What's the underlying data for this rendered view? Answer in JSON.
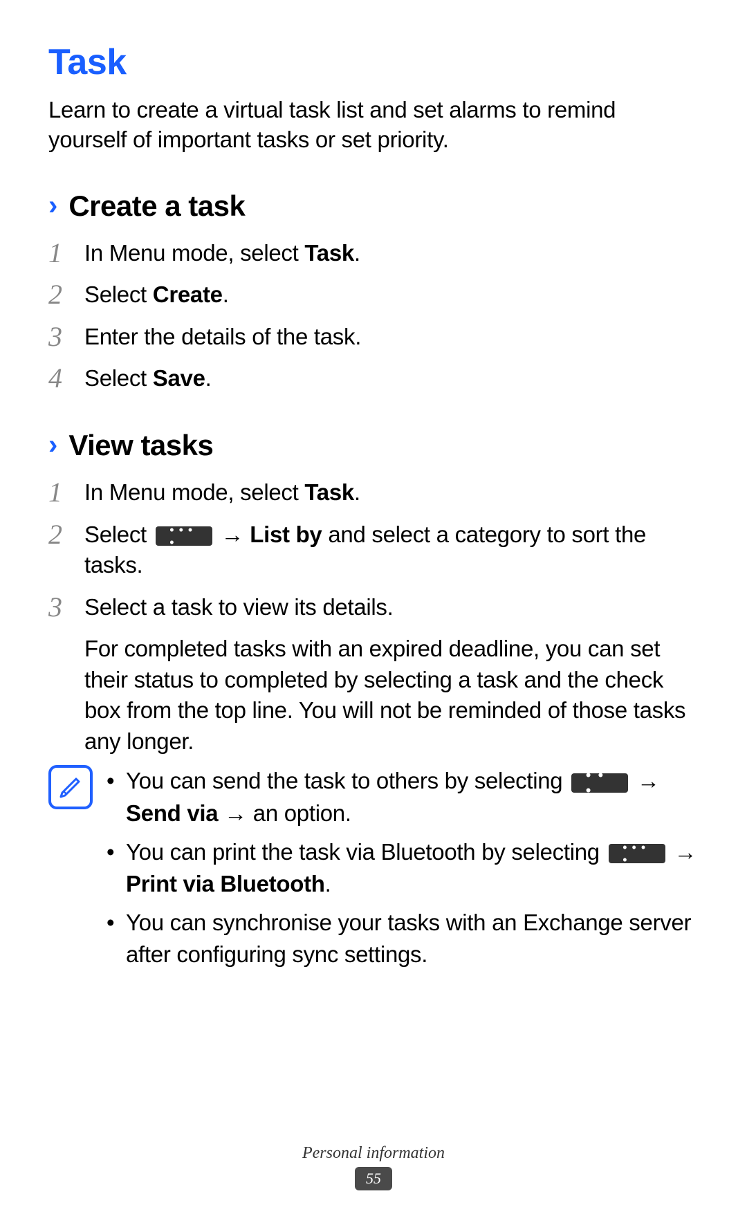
{
  "title": "Task",
  "intro": "Learn to create a virtual task list and set alarms to remind yourself of important tasks or set priority.",
  "sections": [
    {
      "title": "Create a task",
      "steps": [
        {
          "num": "1",
          "pre": "In Menu mode, select ",
          "bold": "Task",
          "post": "."
        },
        {
          "num": "2",
          "pre": "Select ",
          "bold": "Create",
          "post": "."
        },
        {
          "num": "3",
          "pre": "Enter the details of the task.",
          "bold": "",
          "post": ""
        },
        {
          "num": "4",
          "pre": "Select ",
          "bold": "Save",
          "post": "."
        }
      ]
    },
    {
      "title": "View tasks",
      "steps": [
        {
          "num": "1",
          "pre": "In Menu mode, select ",
          "bold": "Task",
          "post": "."
        }
      ],
      "step2": {
        "num": "2",
        "pre": "Select ",
        "arrow": " → ",
        "bold": "List by",
        "post": " and select a category to sort the tasks."
      },
      "step3": {
        "num": "3",
        "line1": "Select a task to view its details.",
        "line2": "For completed tasks with an expired deadline, you can set their status to completed by selecting a task and the check box from the top line. You will not be reminded of those tasks any longer."
      }
    }
  ],
  "notes": {
    "item1": {
      "pre": "You can send the task to others by selecting ",
      "arrow": " → ",
      "bold": "Send via",
      "post": " → an option."
    },
    "item2": {
      "pre": "You can print the task via Bluetooth by selecting ",
      "arrow": " → ",
      "bold": "Print via Bluetooth",
      "post": "."
    },
    "item3": "You can synchronise your tasks with an Exchange server after configuring sync settings."
  },
  "footer": {
    "section": "Personal information",
    "page": "55"
  }
}
